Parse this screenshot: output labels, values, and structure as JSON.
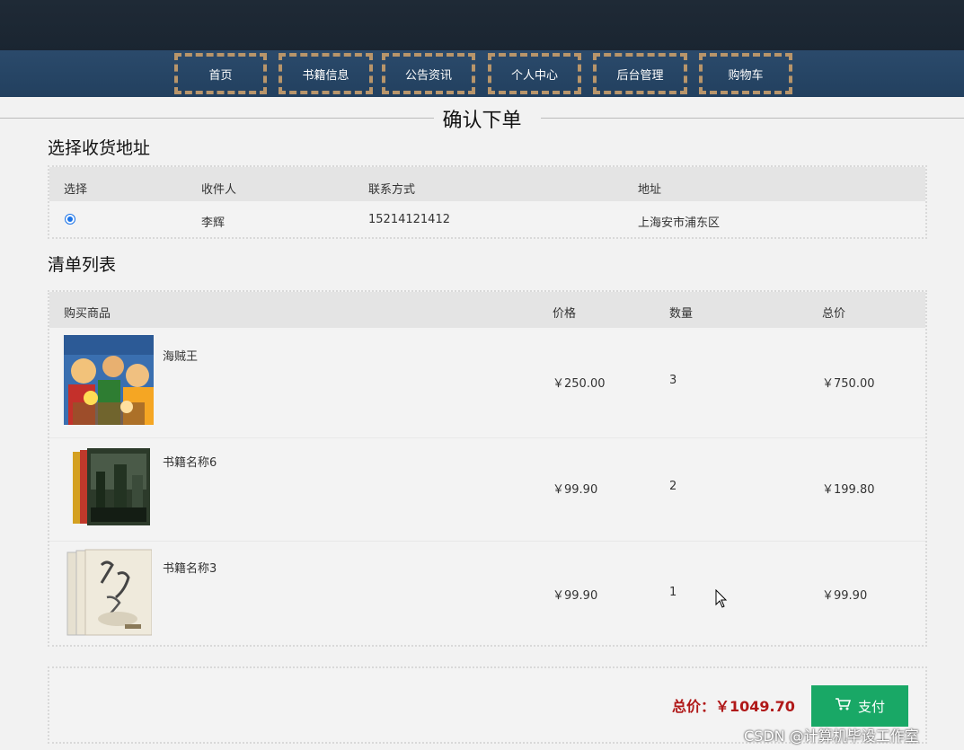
{
  "nav": {
    "items": [
      "首页",
      "书籍信息",
      "公告资讯",
      "个人中心",
      "后台管理",
      "购物车"
    ]
  },
  "page_title": "确认下单",
  "address_section": {
    "title": "选择收货地址",
    "headers": [
      "选择",
      "收件人",
      "联系方式",
      "地址"
    ],
    "rows": [
      {
        "selected": true,
        "recipient": "李辉",
        "phone": "15214121412",
        "address": "上海安市浦东区"
      }
    ]
  },
  "order_section": {
    "title": "清单列表",
    "headers": [
      "购买商品",
      "价格",
      "数量",
      "总价"
    ],
    "items": [
      {
        "name": "海贼王",
        "price": "￥250.00",
        "quantity": "3",
        "total": "￥750.00"
      },
      {
        "name": "书籍名称6",
        "price": "￥99.90",
        "quantity": "2",
        "total": "￥199.80"
      },
      {
        "name": "书籍名称3",
        "price": "￥99.90",
        "quantity": "1",
        "total": "￥99.90"
      }
    ]
  },
  "summary": {
    "total_label": "总价：",
    "total_value": "￥1049.70",
    "pay_label": "支付"
  },
  "watermark": "CSDN @计算机毕设工作室",
  "colors": {
    "accent_green": "#19a866",
    "total_red": "#b01818",
    "nav_border": "#b8956a"
  }
}
